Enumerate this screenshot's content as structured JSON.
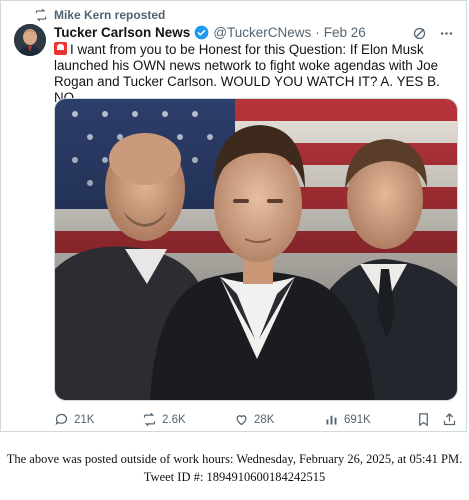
{
  "repost": {
    "text": "Mike Kern reposted"
  },
  "tweet": {
    "author_name": "Tucker Carlson News",
    "handle": "@TuckerCNews",
    "separator": "·",
    "date": "Feb 26",
    "text": "I want from you to be Honest for this Question: If Elon Musk launched his OWN news network to fight woke agendas with Joe Rogan and Tucker Carlson. WOULD YOU WATCH IT? A. YES B. NO"
  },
  "actions": {
    "replies": "21K",
    "reposts": "2.6K",
    "likes": "28K",
    "views": "691K"
  },
  "footer": {
    "line1": "The above was posted outside of work hours: Wednesday, February 26, 2025, at 05:41 PM.",
    "line2": "Tweet ID #: 1894910600184242515"
  },
  "icons": {
    "repost": "repost-icon",
    "verified": "verified-badge-icon",
    "grok": "grok-icon",
    "more": "more-icon",
    "reply": "reply-icon",
    "retweet": "retweet-icon",
    "like": "heart-icon",
    "views": "views-icon",
    "bookmark": "bookmark-icon",
    "share": "share-icon"
  },
  "colors": {
    "verified": "#1d9bf0",
    "secondary_text": "#536471",
    "border": "#cfd9de"
  }
}
